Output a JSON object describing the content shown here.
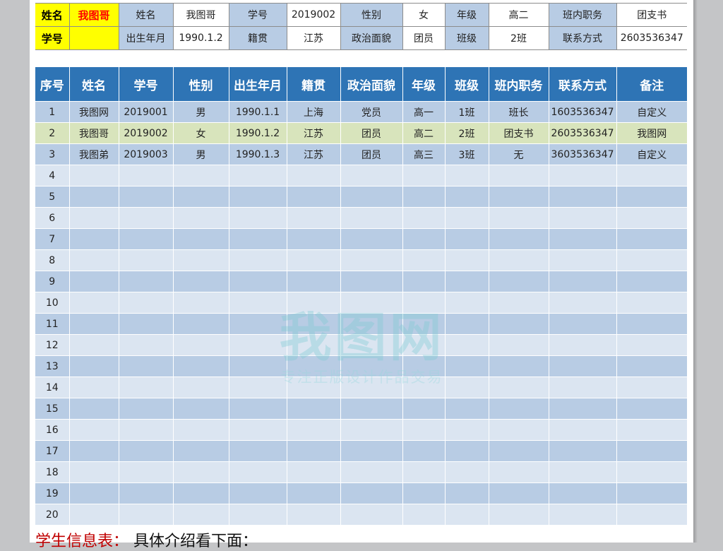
{
  "top_table": {
    "rows": [
      [
        {
          "text": "姓名",
          "style": "yel"
        },
        {
          "text": "我图哥",
          "style": "yel red"
        },
        {
          "text": "姓名",
          "style": "lbl"
        },
        {
          "text": "我图哥",
          "style": "val"
        },
        {
          "text": "学号",
          "style": "lbl"
        },
        {
          "text": "2019002",
          "style": "val"
        },
        {
          "text": "性别",
          "style": "lbl"
        },
        {
          "text": "女",
          "style": "val"
        },
        {
          "text": "年级",
          "style": "lbl"
        },
        {
          "text": "高二",
          "style": "val"
        },
        {
          "text": "班内职务",
          "style": "lbl"
        },
        {
          "text": "团支书",
          "style": "val"
        }
      ],
      [
        {
          "text": "学号",
          "style": "yel"
        },
        {
          "text": "",
          "style": "yel"
        },
        {
          "text": "出生年月",
          "style": "lbl"
        },
        {
          "text": "1990.1.2",
          "style": "val"
        },
        {
          "text": "籍贯",
          "style": "lbl"
        },
        {
          "text": "江苏",
          "style": "val"
        },
        {
          "text": "政治面貌",
          "style": "lbl"
        },
        {
          "text": "团员",
          "style": "val"
        },
        {
          "text": "班级",
          "style": "lbl"
        },
        {
          "text": "2班",
          "style": "val"
        },
        {
          "text": "联系方式",
          "style": "lbl"
        },
        {
          "text": "2603536347",
          "style": "val"
        }
      ]
    ]
  },
  "main_table": {
    "headers": [
      "序号",
      "姓名",
      "学号",
      "性别",
      "出生年月",
      "籍贯",
      "政治面貌",
      "年级",
      "班级",
      "班内职务",
      "联系方式",
      "备注"
    ],
    "rows": [
      [
        "1",
        "我图网",
        "2019001",
        "男",
        "1990.1.1",
        "上海",
        "党员",
        "高一",
        "1班",
        "班长",
        "1603536347",
        "自定义"
      ],
      [
        "2",
        "我图哥",
        "2019002",
        "女",
        "1990.1.2",
        "江苏",
        "团员",
        "高二",
        "2班",
        "团支书",
        "2603536347",
        "我图网"
      ],
      [
        "3",
        "我图弟",
        "2019003",
        "男",
        "1990.1.3",
        "江苏",
        "团员",
        "高三",
        "3班",
        "无",
        "3603536347",
        "自定义"
      ],
      [
        "4",
        "",
        "",
        "",
        "",
        "",
        "",
        "",
        "",
        "",
        "",
        ""
      ],
      [
        "5",
        "",
        "",
        "",
        "",
        "",
        "",
        "",
        "",
        "",
        "",
        ""
      ],
      [
        "6",
        "",
        "",
        "",
        "",
        "",
        "",
        "",
        "",
        "",
        "",
        ""
      ],
      [
        "7",
        "",
        "",
        "",
        "",
        "",
        "",
        "",
        "",
        "",
        "",
        ""
      ],
      [
        "8",
        "",
        "",
        "",
        "",
        "",
        "",
        "",
        "",
        "",
        "",
        ""
      ],
      [
        "9",
        "",
        "",
        "",
        "",
        "",
        "",
        "",
        "",
        "",
        "",
        ""
      ],
      [
        "10",
        "",
        "",
        "",
        "",
        "",
        "",
        "",
        "",
        "",
        "",
        ""
      ],
      [
        "11",
        "",
        "",
        "",
        "",
        "",
        "",
        "",
        "",
        "",
        "",
        ""
      ],
      [
        "12",
        "",
        "",
        "",
        "",
        "",
        "",
        "",
        "",
        "",
        "",
        ""
      ],
      [
        "13",
        "",
        "",
        "",
        "",
        "",
        "",
        "",
        "",
        "",
        "",
        ""
      ],
      [
        "14",
        "",
        "",
        "",
        "",
        "",
        "",
        "",
        "",
        "",
        "",
        ""
      ],
      [
        "15",
        "",
        "",
        "",
        "",
        "",
        "",
        "",
        "",
        "",
        "",
        ""
      ],
      [
        "16",
        "",
        "",
        "",
        "",
        "",
        "",
        "",
        "",
        "",
        "",
        ""
      ],
      [
        "17",
        "",
        "",
        "",
        "",
        "",
        "",
        "",
        "",
        "",
        "",
        ""
      ],
      [
        "18",
        "",
        "",
        "",
        "",
        "",
        "",
        "",
        "",
        "",
        "",
        ""
      ],
      [
        "19",
        "",
        "",
        "",
        "",
        "",
        "",
        "",
        "",
        "",
        "",
        ""
      ],
      [
        "20",
        "",
        "",
        "",
        "",
        "",
        "",
        "",
        "",
        "",
        "",
        ""
      ]
    ],
    "highlighted_row": 2
  },
  "watermark": {
    "logo": "我图网",
    "tagline": "专注正版设计作品交易"
  },
  "footer": {
    "title": "学生信息表：",
    "text": "具体介绍看下面："
  },
  "colors": {
    "header_bg": "#2e74b5",
    "row_odd": "#b8cce4",
    "row_even": "#dbe5f1",
    "row_highlight": "#d8e4bc",
    "yellow": "#ffff00",
    "name_red": "#ff0000",
    "title_red": "#c00000"
  }
}
